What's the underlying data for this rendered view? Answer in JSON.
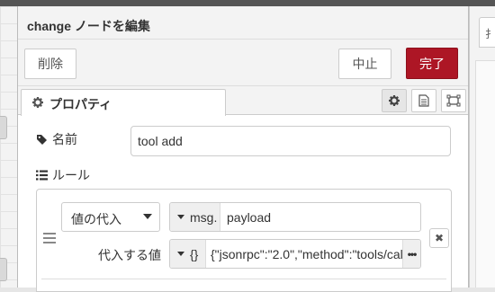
{
  "dialog": {
    "title": "change ノードを編集",
    "buttons": {
      "delete": "削除",
      "cancel": "中止",
      "done": "完了"
    }
  },
  "tabs": {
    "properties": "プロパティ"
  },
  "right_panel": {
    "tab_text": "扌"
  },
  "form": {
    "name_label": "名前",
    "name_value": "tool add",
    "rules_label": "ルール"
  },
  "rule": {
    "action": "値の代入",
    "property_type": "msg.",
    "property_value": "payload",
    "set_to_label": "代入する値",
    "value_type": "{}",
    "value": "{\"jsonrpc\":\"2.0\",\"method\":\"tools/cal",
    "expand": "•••"
  },
  "colors": {
    "done_button": "#ad1625",
    "toolbar_bg": "#f3f3f3"
  },
  "icons": [
    "gear-icon",
    "document-icon",
    "frame-icon",
    "tag-icon",
    "list-icon",
    "drag-handle-icon",
    "close-icon",
    "caret-down-icon"
  ]
}
